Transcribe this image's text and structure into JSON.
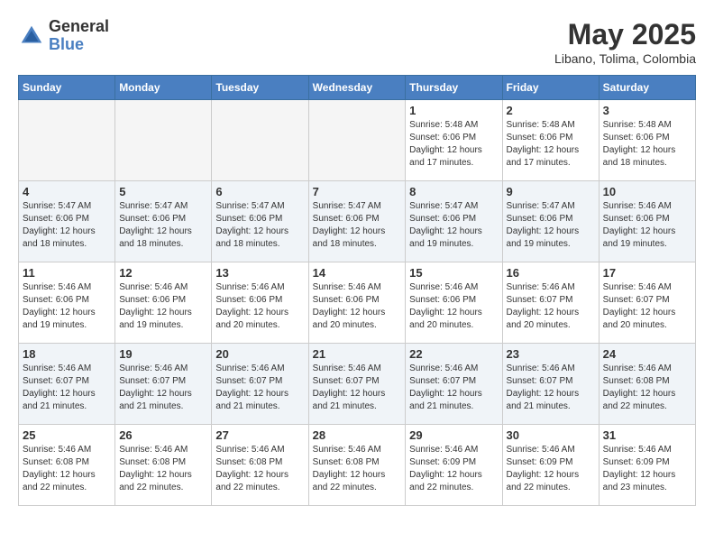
{
  "header": {
    "logo_general": "General",
    "logo_blue": "Blue",
    "month_year": "May 2025",
    "location": "Libano, Tolima, Colombia"
  },
  "weekdays": [
    "Sunday",
    "Monday",
    "Tuesday",
    "Wednesday",
    "Thursday",
    "Friday",
    "Saturday"
  ],
  "weeks": [
    [
      {
        "day": "",
        "info": ""
      },
      {
        "day": "",
        "info": ""
      },
      {
        "day": "",
        "info": ""
      },
      {
        "day": "",
        "info": ""
      },
      {
        "day": "1",
        "info": "Sunrise: 5:48 AM\nSunset: 6:06 PM\nDaylight: 12 hours\nand 17 minutes."
      },
      {
        "day": "2",
        "info": "Sunrise: 5:48 AM\nSunset: 6:06 PM\nDaylight: 12 hours\nand 17 minutes."
      },
      {
        "day": "3",
        "info": "Sunrise: 5:48 AM\nSunset: 6:06 PM\nDaylight: 12 hours\nand 18 minutes."
      }
    ],
    [
      {
        "day": "4",
        "info": "Sunrise: 5:47 AM\nSunset: 6:06 PM\nDaylight: 12 hours\nand 18 minutes."
      },
      {
        "day": "5",
        "info": "Sunrise: 5:47 AM\nSunset: 6:06 PM\nDaylight: 12 hours\nand 18 minutes."
      },
      {
        "day": "6",
        "info": "Sunrise: 5:47 AM\nSunset: 6:06 PM\nDaylight: 12 hours\nand 18 minutes."
      },
      {
        "day": "7",
        "info": "Sunrise: 5:47 AM\nSunset: 6:06 PM\nDaylight: 12 hours\nand 18 minutes."
      },
      {
        "day": "8",
        "info": "Sunrise: 5:47 AM\nSunset: 6:06 PM\nDaylight: 12 hours\nand 19 minutes."
      },
      {
        "day": "9",
        "info": "Sunrise: 5:47 AM\nSunset: 6:06 PM\nDaylight: 12 hours\nand 19 minutes."
      },
      {
        "day": "10",
        "info": "Sunrise: 5:46 AM\nSunset: 6:06 PM\nDaylight: 12 hours\nand 19 minutes."
      }
    ],
    [
      {
        "day": "11",
        "info": "Sunrise: 5:46 AM\nSunset: 6:06 PM\nDaylight: 12 hours\nand 19 minutes."
      },
      {
        "day": "12",
        "info": "Sunrise: 5:46 AM\nSunset: 6:06 PM\nDaylight: 12 hours\nand 19 minutes."
      },
      {
        "day": "13",
        "info": "Sunrise: 5:46 AM\nSunset: 6:06 PM\nDaylight: 12 hours\nand 20 minutes."
      },
      {
        "day": "14",
        "info": "Sunrise: 5:46 AM\nSunset: 6:06 PM\nDaylight: 12 hours\nand 20 minutes."
      },
      {
        "day": "15",
        "info": "Sunrise: 5:46 AM\nSunset: 6:06 PM\nDaylight: 12 hours\nand 20 minutes."
      },
      {
        "day": "16",
        "info": "Sunrise: 5:46 AM\nSunset: 6:07 PM\nDaylight: 12 hours\nand 20 minutes."
      },
      {
        "day": "17",
        "info": "Sunrise: 5:46 AM\nSunset: 6:07 PM\nDaylight: 12 hours\nand 20 minutes."
      }
    ],
    [
      {
        "day": "18",
        "info": "Sunrise: 5:46 AM\nSunset: 6:07 PM\nDaylight: 12 hours\nand 21 minutes."
      },
      {
        "day": "19",
        "info": "Sunrise: 5:46 AM\nSunset: 6:07 PM\nDaylight: 12 hours\nand 21 minutes."
      },
      {
        "day": "20",
        "info": "Sunrise: 5:46 AM\nSunset: 6:07 PM\nDaylight: 12 hours\nand 21 minutes."
      },
      {
        "day": "21",
        "info": "Sunrise: 5:46 AM\nSunset: 6:07 PM\nDaylight: 12 hours\nand 21 minutes."
      },
      {
        "day": "22",
        "info": "Sunrise: 5:46 AM\nSunset: 6:07 PM\nDaylight: 12 hours\nand 21 minutes."
      },
      {
        "day": "23",
        "info": "Sunrise: 5:46 AM\nSunset: 6:07 PM\nDaylight: 12 hours\nand 21 minutes."
      },
      {
        "day": "24",
        "info": "Sunrise: 5:46 AM\nSunset: 6:08 PM\nDaylight: 12 hours\nand 22 minutes."
      }
    ],
    [
      {
        "day": "25",
        "info": "Sunrise: 5:46 AM\nSunset: 6:08 PM\nDaylight: 12 hours\nand 22 minutes."
      },
      {
        "day": "26",
        "info": "Sunrise: 5:46 AM\nSunset: 6:08 PM\nDaylight: 12 hours\nand 22 minutes."
      },
      {
        "day": "27",
        "info": "Sunrise: 5:46 AM\nSunset: 6:08 PM\nDaylight: 12 hours\nand 22 minutes."
      },
      {
        "day": "28",
        "info": "Sunrise: 5:46 AM\nSunset: 6:08 PM\nDaylight: 12 hours\nand 22 minutes."
      },
      {
        "day": "29",
        "info": "Sunrise: 5:46 AM\nSunset: 6:09 PM\nDaylight: 12 hours\nand 22 minutes."
      },
      {
        "day": "30",
        "info": "Sunrise: 5:46 AM\nSunset: 6:09 PM\nDaylight: 12 hours\nand 22 minutes."
      },
      {
        "day": "31",
        "info": "Sunrise: 5:46 AM\nSunset: 6:09 PM\nDaylight: 12 hours\nand 23 minutes."
      }
    ]
  ]
}
